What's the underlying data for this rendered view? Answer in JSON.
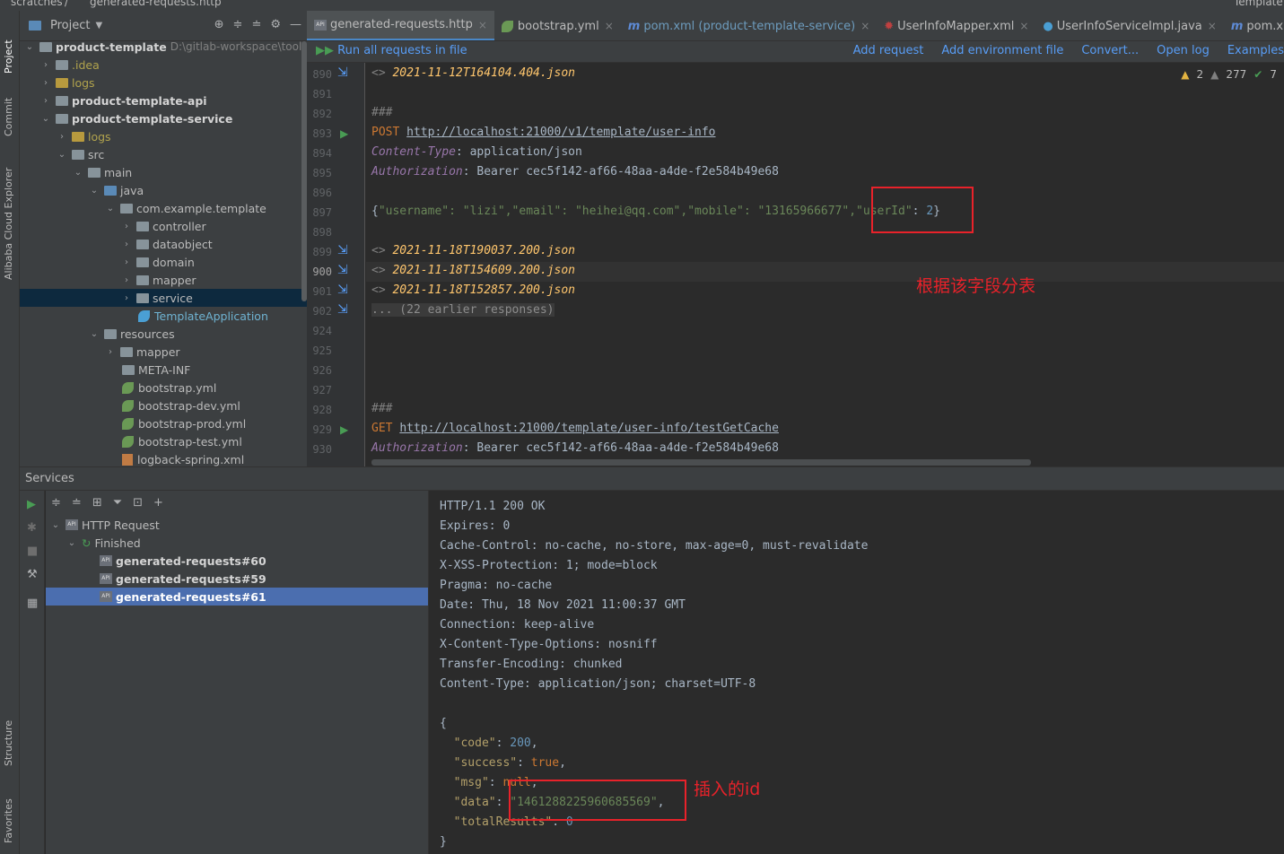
{
  "breadcrumb": {
    "scratches": "scratches",
    "sep": "/",
    "file": "generated-requests.http",
    "right_label": "Template"
  },
  "left_strip": {
    "project": "Project",
    "commit": "Commit",
    "alibaba": "Alibaba Cloud Explorer",
    "structure": "Structure",
    "favorites": "Favorites"
  },
  "project_panel": {
    "title": "Project",
    "tree": [
      {
        "label": "product-template",
        "path": "D:\\gitlab-workspace\\tool\\p"
      },
      {
        "label": ".idea"
      },
      {
        "label": "logs"
      },
      {
        "label": "product-template-api"
      },
      {
        "label": "product-template-service"
      },
      {
        "label": "logs"
      },
      {
        "label": "src"
      },
      {
        "label": "main"
      },
      {
        "label": "java"
      },
      {
        "label": "com.example.template"
      },
      {
        "label": "controller"
      },
      {
        "label": "dataobject"
      },
      {
        "label": "domain"
      },
      {
        "label": "mapper"
      },
      {
        "label": "service"
      },
      {
        "label": "TemplateApplication"
      },
      {
        "label": "resources"
      },
      {
        "label": "mapper"
      },
      {
        "label": "META-INF"
      },
      {
        "label": "bootstrap.yml"
      },
      {
        "label": "bootstrap-dev.yml"
      },
      {
        "label": "bootstrap-prod.yml"
      },
      {
        "label": "bootstrap-test.yml"
      },
      {
        "label": "logback-spring.xml"
      }
    ]
  },
  "tabs": [
    {
      "label": "generated-requests.http"
    },
    {
      "label": "bootstrap.yml"
    },
    {
      "label": "pom.xml (product-template-service)"
    },
    {
      "label": "UserInfoMapper.xml"
    },
    {
      "label": "UserInfoServiceImpl.java"
    },
    {
      "label": "pom.xml (product-"
    }
  ],
  "http_toolbar": {
    "run_all": "Run all requests in file",
    "add_request": "Add request",
    "add_env": "Add environment file",
    "convert": "Convert...",
    "open_log": "Open log",
    "examples": "Examples"
  },
  "inspections": {
    "warnings_a": "2",
    "warnings_b": "277",
    "ok": "7"
  },
  "editor": {
    "line_numbers": [
      "890",
      "891",
      "892",
      "893",
      "894",
      "895",
      "896",
      "897",
      "898",
      "899",
      "900",
      "901",
      "902",
      "924",
      "925",
      "926",
      "927",
      "928",
      "929",
      "930"
    ],
    "l890_file": "2021-11-12T164104.404.json",
    "l892": "###",
    "l893_method": "POST",
    "l893_url": "http://localhost:21000/v1/template/user-info",
    "l894_header": "Content-Type",
    "l894_value": "application/json",
    "l895_header": "Authorization",
    "l895_value": "Bearer cec5f142-af66-48aa-a4de-f2e584b49e68",
    "l897_body_pre": "\"username\": \"lizi\",\"email\": \"heihei@qq.com\",\"mobile\": \"13165966677\",",
    "l897_key": "\"userId\"",
    "l897_val": "2",
    "l899_file": "2021-11-18T190037.200.json",
    "l900_file": "2021-11-18T154609.200.json",
    "l901_file": "2021-11-18T152857.200.json",
    "l902_fold": "... (22 earlier responses)",
    "l928": "###",
    "l929_method": "GET",
    "l929_url": "http://localhost:21000/template/user-info/testGetCache",
    "l930_header": "Authorization",
    "l930_value": "Bearer cec5f142-af66-48aa-a4de-f2e584b49e68",
    "annotation": "根据该字段分表"
  },
  "services": {
    "title": "Services",
    "tree": {
      "root": "HTTP Request",
      "group": "Finished",
      "items": [
        "generated-requests#60",
        "generated-requests#59",
        "generated-requests#61"
      ]
    },
    "response": {
      "status": "HTTP/1.1 200 OK",
      "headers": [
        "Expires: 0",
        "Cache-Control: no-cache, no-store, max-age=0, must-revalidate",
        "X-XSS-Protection: 1; mode=block",
        "Pragma: no-cache",
        "Date: Thu, 18 Nov 2021 11:00:37 GMT",
        "Connection: keep-alive",
        "X-Content-Type-Options: nosniff",
        "Transfer-Encoding: chunked",
        "Content-Type: application/json; charset=UTF-8"
      ],
      "code_val": "200",
      "success_val": "true",
      "msg_val": "null",
      "data_val": "\"1461288225960685569\"",
      "total_val": "0",
      "annotation": "插入的id"
    }
  },
  "colors": {
    "accent": "#4a88c7",
    "annotation_red": "#e8222a",
    "selection": "#4b6eaf"
  }
}
